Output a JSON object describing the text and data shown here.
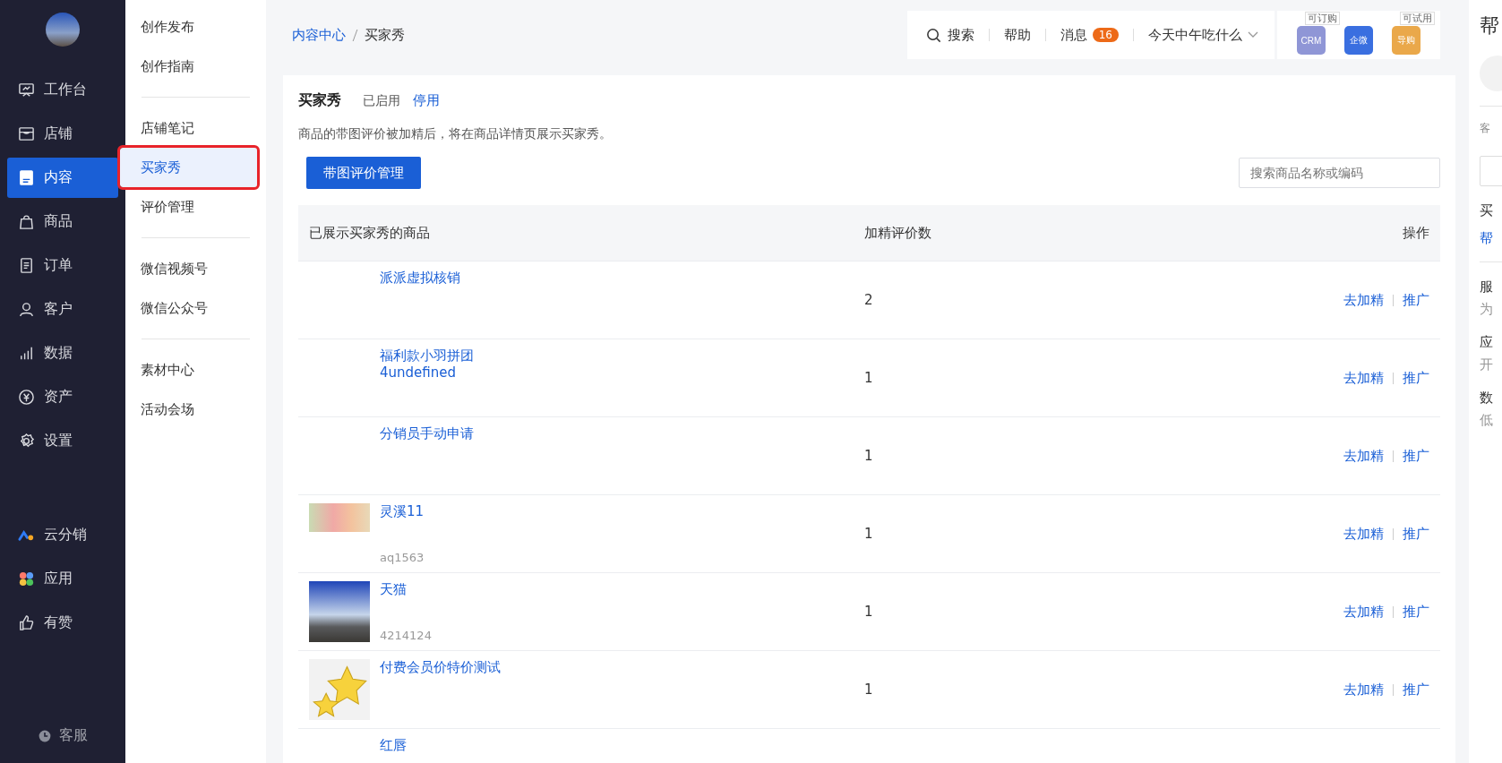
{
  "sidebar": {
    "items": [
      {
        "label": "工作台",
        "selected": false
      },
      {
        "label": "店铺",
        "selected": false
      },
      {
        "label": "内容",
        "selected": true
      },
      {
        "label": "商品",
        "selected": false
      },
      {
        "label": "订单",
        "selected": false
      },
      {
        "label": "客户",
        "selected": false
      },
      {
        "label": "数据",
        "selected": false
      },
      {
        "label": "资产",
        "selected": false
      },
      {
        "label": "设置",
        "selected": false
      }
    ],
    "apps": [
      {
        "label": "云分销"
      },
      {
        "label": "应用"
      },
      {
        "label": "有赞"
      }
    ],
    "footer": "客服"
  },
  "subnav": {
    "groups": [
      [
        {
          "label": "创作发布",
          "selected": false,
          "highlighted": false
        },
        {
          "label": "创作指南",
          "selected": false,
          "highlighted": false
        }
      ],
      [
        {
          "label": "店铺笔记",
          "selected": false,
          "highlighted": false
        },
        {
          "label": "买家秀",
          "selected": true,
          "highlighted": true
        },
        {
          "label": "评价管理",
          "selected": false,
          "highlighted": false
        }
      ],
      [
        {
          "label": "微信视频号",
          "selected": false,
          "highlighted": false
        },
        {
          "label": "微信公众号",
          "selected": false,
          "highlighted": false
        }
      ],
      [
        {
          "label": "素材中心",
          "selected": false,
          "highlighted": false
        },
        {
          "label": "活动会场",
          "selected": false,
          "highlighted": false
        }
      ]
    ]
  },
  "breadcrumb": [
    "内容中心",
    "买家秀"
  ],
  "toolbar": {
    "search": "搜索",
    "help": "帮助",
    "messages": "消息",
    "message_count": "16",
    "user": "今天中午吃什么"
  },
  "app_icons": [
    {
      "label": "CRM",
      "tag": "可订购"
    },
    {
      "label": "企微"
    },
    {
      "label": "导购",
      "tag": "可试用"
    }
  ],
  "page": {
    "title": "买家秀",
    "status": "已启用",
    "toggle": "停用",
    "description": "商品的带图评价被加精后，将在商品详情页展示买家秀。",
    "primary_button": "带图评价管理",
    "search": {
      "placeholder": "搜索商品名称或编码"
    }
  },
  "table": {
    "columns": [
      "已展示买家秀的商品",
      "加精评价数",
      "操作"
    ],
    "rows": [
      {
        "name": "派派虚拟核销",
        "kind": "plain",
        "count": "2",
        "actions": [
          "去加精",
          "推广"
        ]
      },
      {
        "name": "福利款小羽拼团\n4undefined",
        "kind": "plain",
        "count": "1",
        "actions": [
          "去加精",
          "推广"
        ]
      },
      {
        "name": "分销员手动申请",
        "kind": "plain",
        "count": "1",
        "actions": [
          "去加精",
          "推广"
        ]
      },
      {
        "name": "灵溪11",
        "code": "aq1563",
        "kind": "banner",
        "count": "1",
        "actions": [
          "去加精",
          "推广"
        ]
      },
      {
        "name": "天猫",
        "code": "4214124",
        "kind": "photo",
        "count": "1",
        "actions": [
          "去加精",
          "推广"
        ]
      },
      {
        "name": "付费会员价特价测试",
        "kind": "stars",
        "count": "1",
        "actions": [
          "去加精",
          "推广"
        ]
      },
      {
        "name": "红唇",
        "kind": "plain"
      }
    ]
  },
  "help_panel": {
    "title": "帮",
    "caption": "客",
    "section": "买",
    "link": "帮",
    "items": [
      {
        "title": "服",
        "text": "为"
      },
      {
        "title": "应",
        "text": "开"
      },
      {
        "title": "数",
        "text": "低"
      }
    ]
  }
}
